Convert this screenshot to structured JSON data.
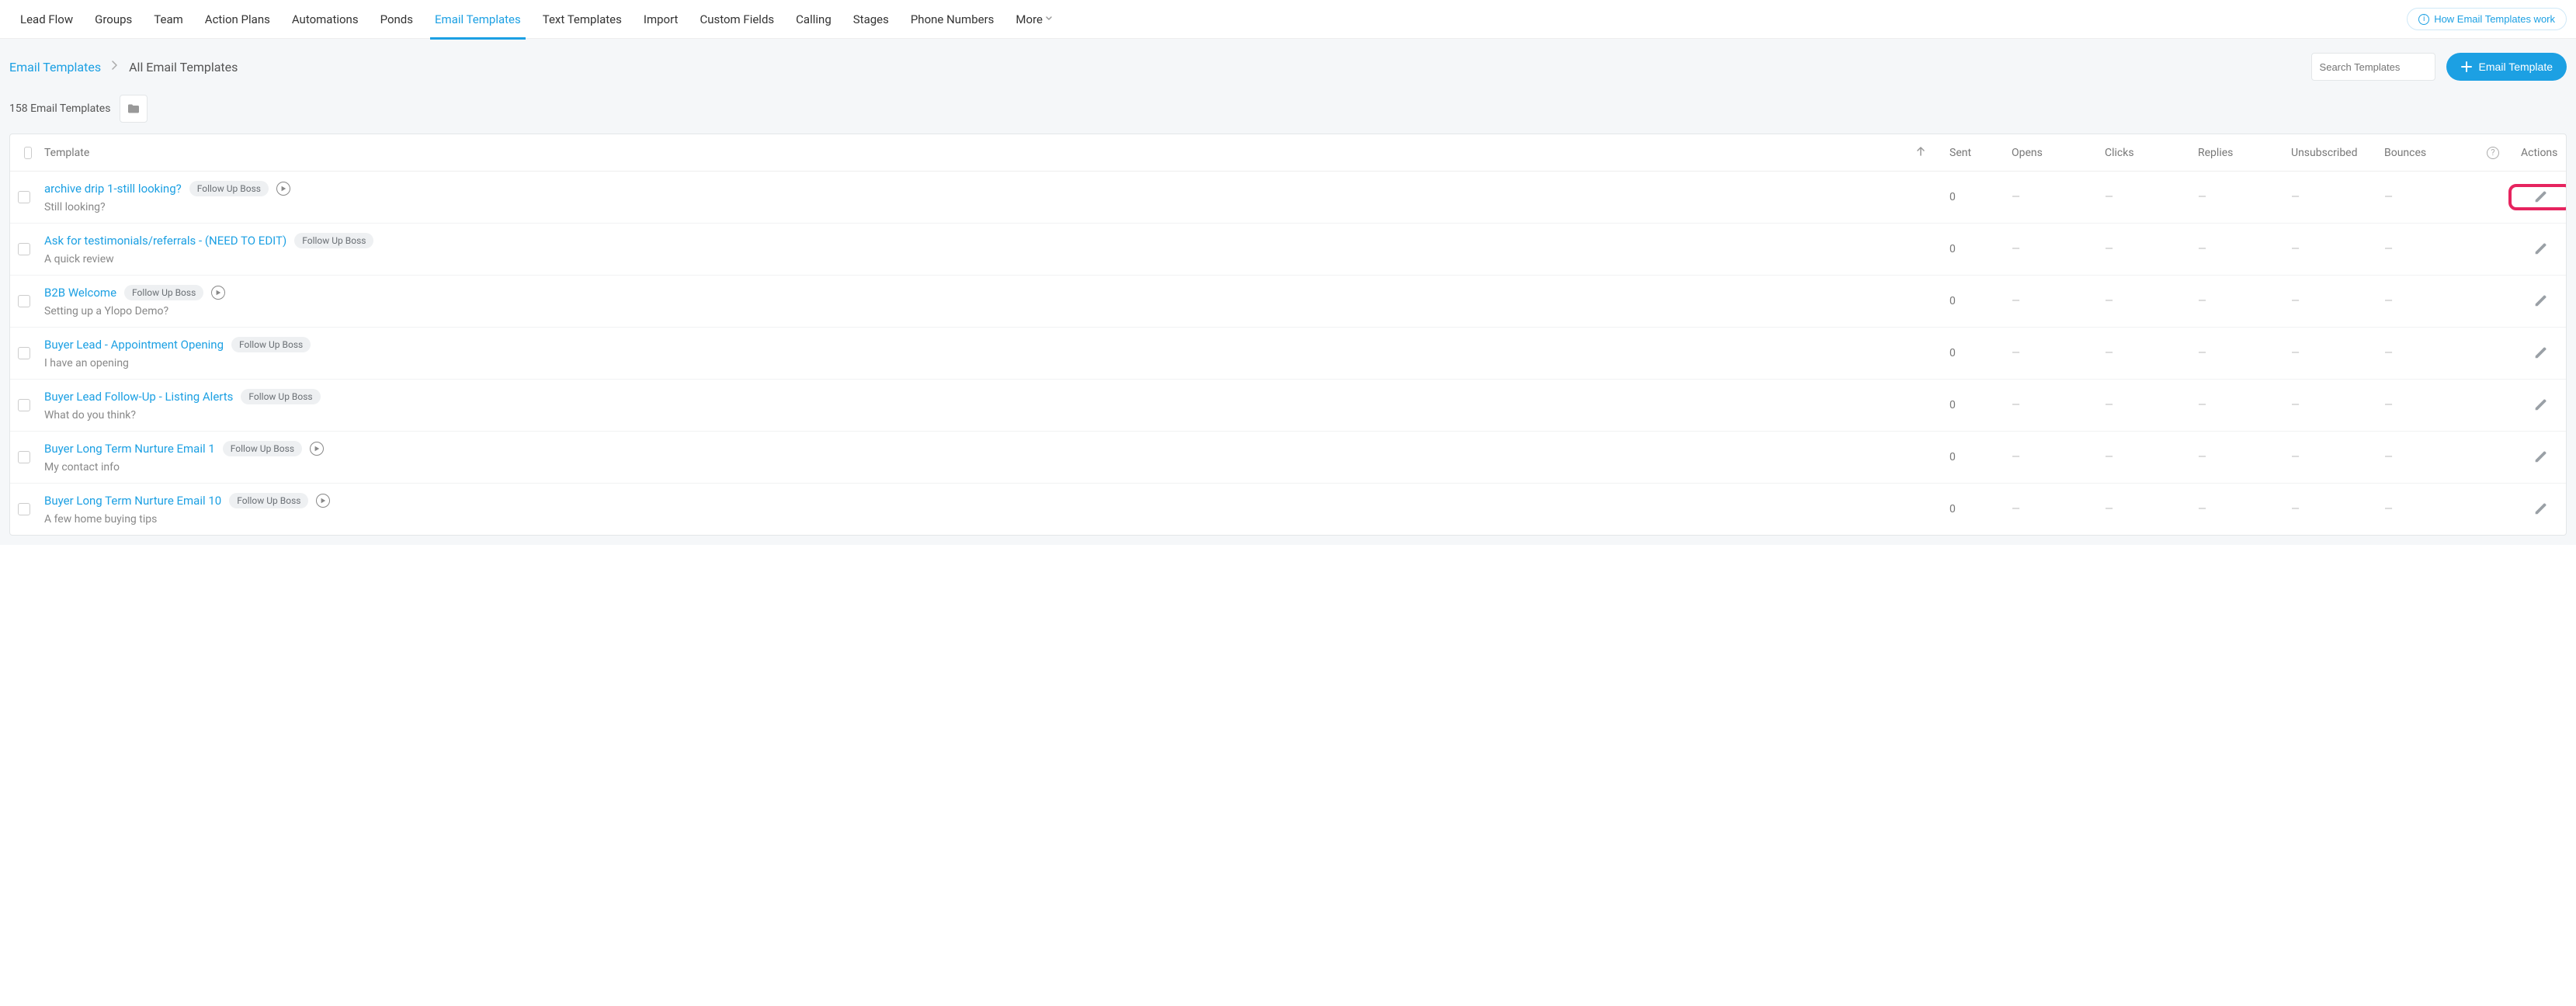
{
  "nav": {
    "items": [
      {
        "label": "Lead Flow",
        "active": false
      },
      {
        "label": "Groups",
        "active": false
      },
      {
        "label": "Team",
        "active": false
      },
      {
        "label": "Action Plans",
        "active": false
      },
      {
        "label": "Automations",
        "active": false
      },
      {
        "label": "Ponds",
        "active": false
      },
      {
        "label": "Email Templates",
        "active": true
      },
      {
        "label": "Text Templates",
        "active": false
      },
      {
        "label": "Import",
        "active": false
      },
      {
        "label": "Custom Fields",
        "active": false
      },
      {
        "label": "Calling",
        "active": false
      },
      {
        "label": "Stages",
        "active": false
      },
      {
        "label": "Phone Numbers",
        "active": false
      },
      {
        "label": "More",
        "active": false,
        "more": true
      }
    ],
    "help_label": "How Email Templates work"
  },
  "breadcrumb": {
    "root": "Email Templates",
    "current": "All Email Templates"
  },
  "search": {
    "placeholder": "Search Templates"
  },
  "add_button": "Email Template",
  "count_text": "158 Email Templates",
  "columns": {
    "template": "Template",
    "sent": "Sent",
    "opens": "Opens",
    "clicks": "Clicks",
    "replies": "Replies",
    "unsub": "Unsubscribed",
    "bounces": "Bounces",
    "actions": "Actions"
  },
  "rows": [
    {
      "title": "archive drip 1-still looking?",
      "tag": "Follow Up Boss",
      "play": true,
      "subtitle": "Still looking?",
      "sent": "0",
      "opens": "—",
      "clicks": "—",
      "replies": "—",
      "unsub": "—",
      "bounces": "—",
      "highlight": true
    },
    {
      "title": "Ask for testimonials/referrals - (NEED TO EDIT)",
      "tag": "Follow Up Boss",
      "play": false,
      "subtitle": "A quick review",
      "sent": "0",
      "opens": "—",
      "clicks": "—",
      "replies": "—",
      "unsub": "—",
      "bounces": "—",
      "highlight": false
    },
    {
      "title": "B2B Welcome",
      "tag": "Follow Up Boss",
      "play": true,
      "subtitle": "Setting up a Ylopo Demo?",
      "sent": "0",
      "opens": "—",
      "clicks": "—",
      "replies": "—",
      "unsub": "—",
      "bounces": "—",
      "highlight": false
    },
    {
      "title": "Buyer Lead - Appointment Opening",
      "tag": "Follow Up Boss",
      "play": false,
      "subtitle": "I have an opening",
      "sent": "0",
      "opens": "—",
      "clicks": "—",
      "replies": "—",
      "unsub": "—",
      "bounces": "—",
      "highlight": false
    },
    {
      "title": "Buyer Lead Follow-Up - Listing Alerts",
      "tag": "Follow Up Boss",
      "play": false,
      "subtitle": "What do you think?",
      "sent": "0",
      "opens": "—",
      "clicks": "—",
      "replies": "—",
      "unsub": "—",
      "bounces": "—",
      "highlight": false
    },
    {
      "title": "Buyer Long Term Nurture Email 1",
      "tag": "Follow Up Boss",
      "play": true,
      "subtitle": "My contact info",
      "sent": "0",
      "opens": "—",
      "clicks": "—",
      "replies": "—",
      "unsub": "—",
      "bounces": "—",
      "highlight": false
    },
    {
      "title": "Buyer Long Term Nurture Email 10",
      "tag": "Follow Up Boss",
      "play": true,
      "subtitle": "A few home buying tips",
      "sent": "0",
      "opens": "—",
      "clicks": "—",
      "replies": "—",
      "unsub": "—",
      "bounces": "—",
      "highlight": false
    }
  ]
}
